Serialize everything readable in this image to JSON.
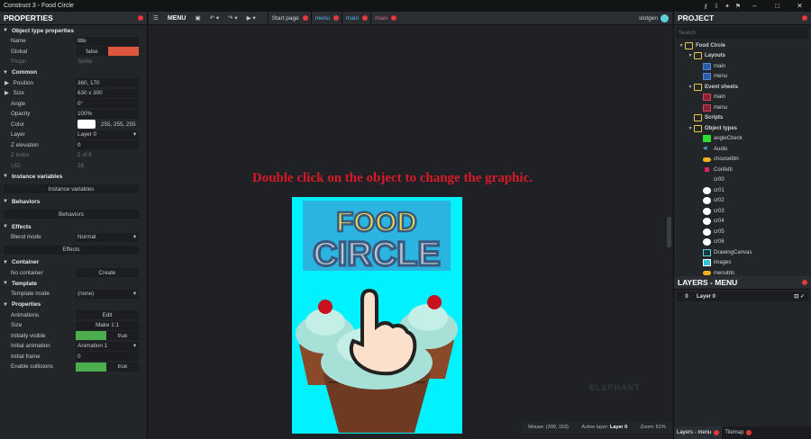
{
  "window": {
    "title": "Construct 3 - Food Circle"
  },
  "properties": {
    "header": "PROPERTIES",
    "sections": [
      {
        "title": "Object type properties",
        "rows": [
          {
            "label": "Name",
            "value": "title"
          },
          {
            "label": "Global",
            "value": "false"
          },
          {
            "label": "Plugin",
            "value": "Sprite"
          }
        ]
      },
      {
        "title": "Common",
        "rows": [
          {
            "label": "Position",
            "value": "360, 170"
          },
          {
            "label": "Size",
            "value": "630 x 300"
          },
          {
            "label": "Angle",
            "value": "0°"
          },
          {
            "label": "Opacity",
            "value": "100%"
          },
          {
            "label": "Color",
            "value": "255, 255, 255"
          },
          {
            "label": "Layer",
            "value": "Layer 0"
          },
          {
            "label": "Z elevation",
            "value": "0"
          },
          {
            "label": "Z index",
            "value": "5 of 6"
          },
          {
            "label": "UID",
            "value": "26"
          }
        ]
      },
      {
        "title": "Instance variables",
        "button": "Instance variables"
      },
      {
        "title": "Behaviors",
        "button": "Behaviors"
      },
      {
        "title": "Effects",
        "rows": [
          {
            "label": "Blend mode",
            "value": "Normal"
          }
        ],
        "button": "Effects"
      },
      {
        "title": "Container",
        "rows": [
          {
            "label": "No container",
            "value": "Create"
          }
        ]
      },
      {
        "title": "Template",
        "rows": [
          {
            "label": "Template mode",
            "value": "(none)"
          }
        ]
      },
      {
        "title": "Properties",
        "rows": [
          {
            "label": "Animations",
            "value": "Edit"
          },
          {
            "label": "Size",
            "value": "Make 1:1"
          },
          {
            "label": "Initially visible",
            "value": "true"
          },
          {
            "label": "Initial animation",
            "value": "Animation 1"
          },
          {
            "label": "Initial frame",
            "value": "0"
          },
          {
            "label": "Enable collisions",
            "value": "true"
          }
        ]
      }
    ]
  },
  "toolbar": {
    "menu": "MENU",
    "tabs": [
      {
        "label": "Start page"
      },
      {
        "label": "menu"
      },
      {
        "label": "main"
      },
      {
        "label": "main"
      }
    ],
    "user": "slotgen"
  },
  "canvas": {
    "instruction": "Double click on the object to change the graphic.",
    "logo_line1": "FOOD",
    "logo_line2": "CIRCLE",
    "watermark": "ELEPHANT"
  },
  "status": {
    "mouse": "Mouse: (399, 153)",
    "active_layer_label": "Active layer:",
    "active_layer": "Layer 0",
    "zoom": "Zoom: 51%"
  },
  "project": {
    "header": "PROJECT",
    "search_placeholder": "Search",
    "tree": [
      {
        "label": "Food Circle",
        "icon": "folder",
        "lvl": 0,
        "open": true
      },
      {
        "label": "Layouts",
        "icon": "folder",
        "lvl": 1,
        "open": true
      },
      {
        "label": "main",
        "icon": "layout",
        "lvl": 2
      },
      {
        "label": "menu",
        "icon": "layout",
        "lvl": 2
      },
      {
        "label": "Event sheets",
        "icon": "folder",
        "lvl": 1,
        "open": true
      },
      {
        "label": "main",
        "icon": "event",
        "lvl": 2
      },
      {
        "label": "menu",
        "icon": "event",
        "lvl": 2
      },
      {
        "label": "Scripts",
        "icon": "folder",
        "lvl": 1
      },
      {
        "label": "Object types",
        "icon": "folder",
        "lvl": 1,
        "open": true
      },
      {
        "label": "angleCheck",
        "icon": "green",
        "lvl": 2
      },
      {
        "label": "Audio",
        "icon": "audio",
        "lvl": 2
      },
      {
        "label": "choosebtn",
        "icon": "pill",
        "lvl": 2
      },
      {
        "label": "Confetti",
        "icon": "pink",
        "lvl": 2
      },
      {
        "label": "cr00",
        "icon": "none",
        "lvl": 2
      },
      {
        "label": "cr01",
        "icon": "circle",
        "lvl": 2
      },
      {
        "label": "cr02",
        "icon": "circle",
        "lvl": 2
      },
      {
        "label": "cr03",
        "icon": "circle",
        "lvl": 2
      },
      {
        "label": "cr04",
        "icon": "circle",
        "lvl": 2
      },
      {
        "label": "cr05",
        "icon": "circle",
        "lvl": 2
      },
      {
        "label": "cr06",
        "icon": "circle",
        "lvl": 2
      },
      {
        "label": "DrawingCanvas",
        "icon": "canvas",
        "lvl": 2
      },
      {
        "label": "images",
        "icon": "images",
        "lvl": 2
      },
      {
        "label": "menubtn",
        "icon": "pill",
        "lvl": 2
      }
    ]
  },
  "layers": {
    "header": "LAYERS - MENU",
    "rows": [
      {
        "index": "0",
        "name": "Layer 0"
      }
    ]
  },
  "bottom_tabs": [
    {
      "label": "Layers - menu"
    },
    {
      "label": "Tilemap"
    }
  ],
  "colors": {
    "accent_red": "#e0393e",
    "instruction_red": "#d8192a",
    "layout_bg": "#00f2ff",
    "toggle_green": "#4cae4c"
  }
}
